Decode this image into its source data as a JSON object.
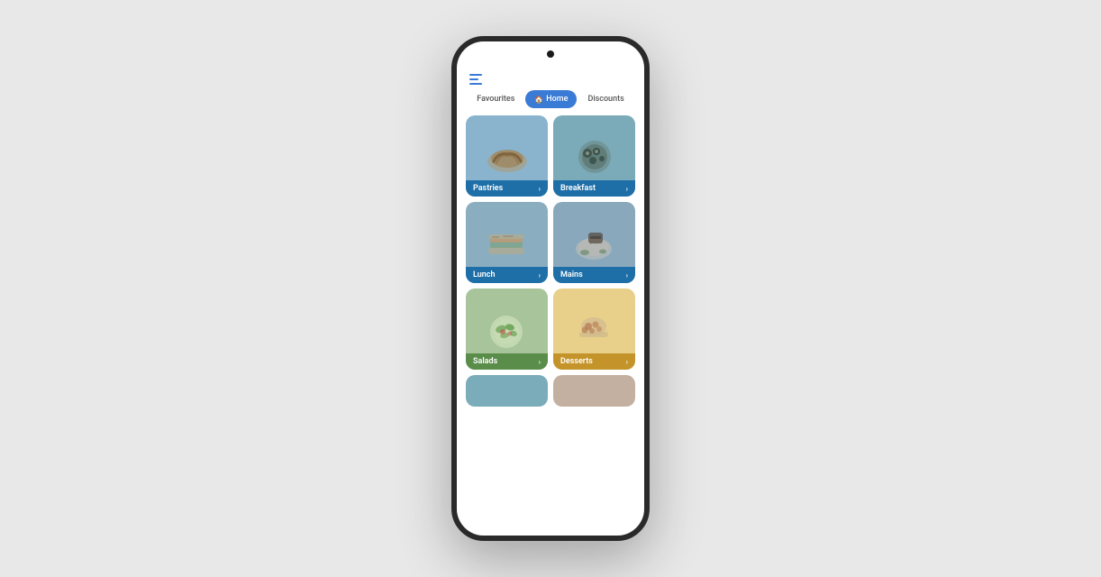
{
  "phone": {
    "nav": {
      "tabs": [
        {
          "id": "favourites",
          "label": "Favourites",
          "active": false,
          "icon": null
        },
        {
          "id": "home",
          "label": "Home",
          "active": true,
          "icon": "🏠"
        },
        {
          "id": "discounts",
          "label": "Discounts",
          "active": false,
          "icon": null
        }
      ]
    },
    "categories": [
      {
        "id": "pastries",
        "label": "Pastries",
        "emoji": "🥐",
        "theme": "blue"
      },
      {
        "id": "breakfast",
        "label": "Breakfast",
        "emoji": "🍱",
        "theme": "blue"
      },
      {
        "id": "lunch",
        "label": "Lunch",
        "emoji": "🥪",
        "theme": "blue"
      },
      {
        "id": "mains",
        "label": "Mains",
        "emoji": "🍽️",
        "theme": "blue"
      },
      {
        "id": "salads",
        "label": "Salads",
        "emoji": "🥗",
        "theme": "green"
      },
      {
        "id": "desserts",
        "label": "Desserts",
        "emoji": "🍮",
        "theme": "yellow"
      }
    ],
    "chevron": "›",
    "menuIconLines": [
      14,
      10,
      14
    ]
  }
}
